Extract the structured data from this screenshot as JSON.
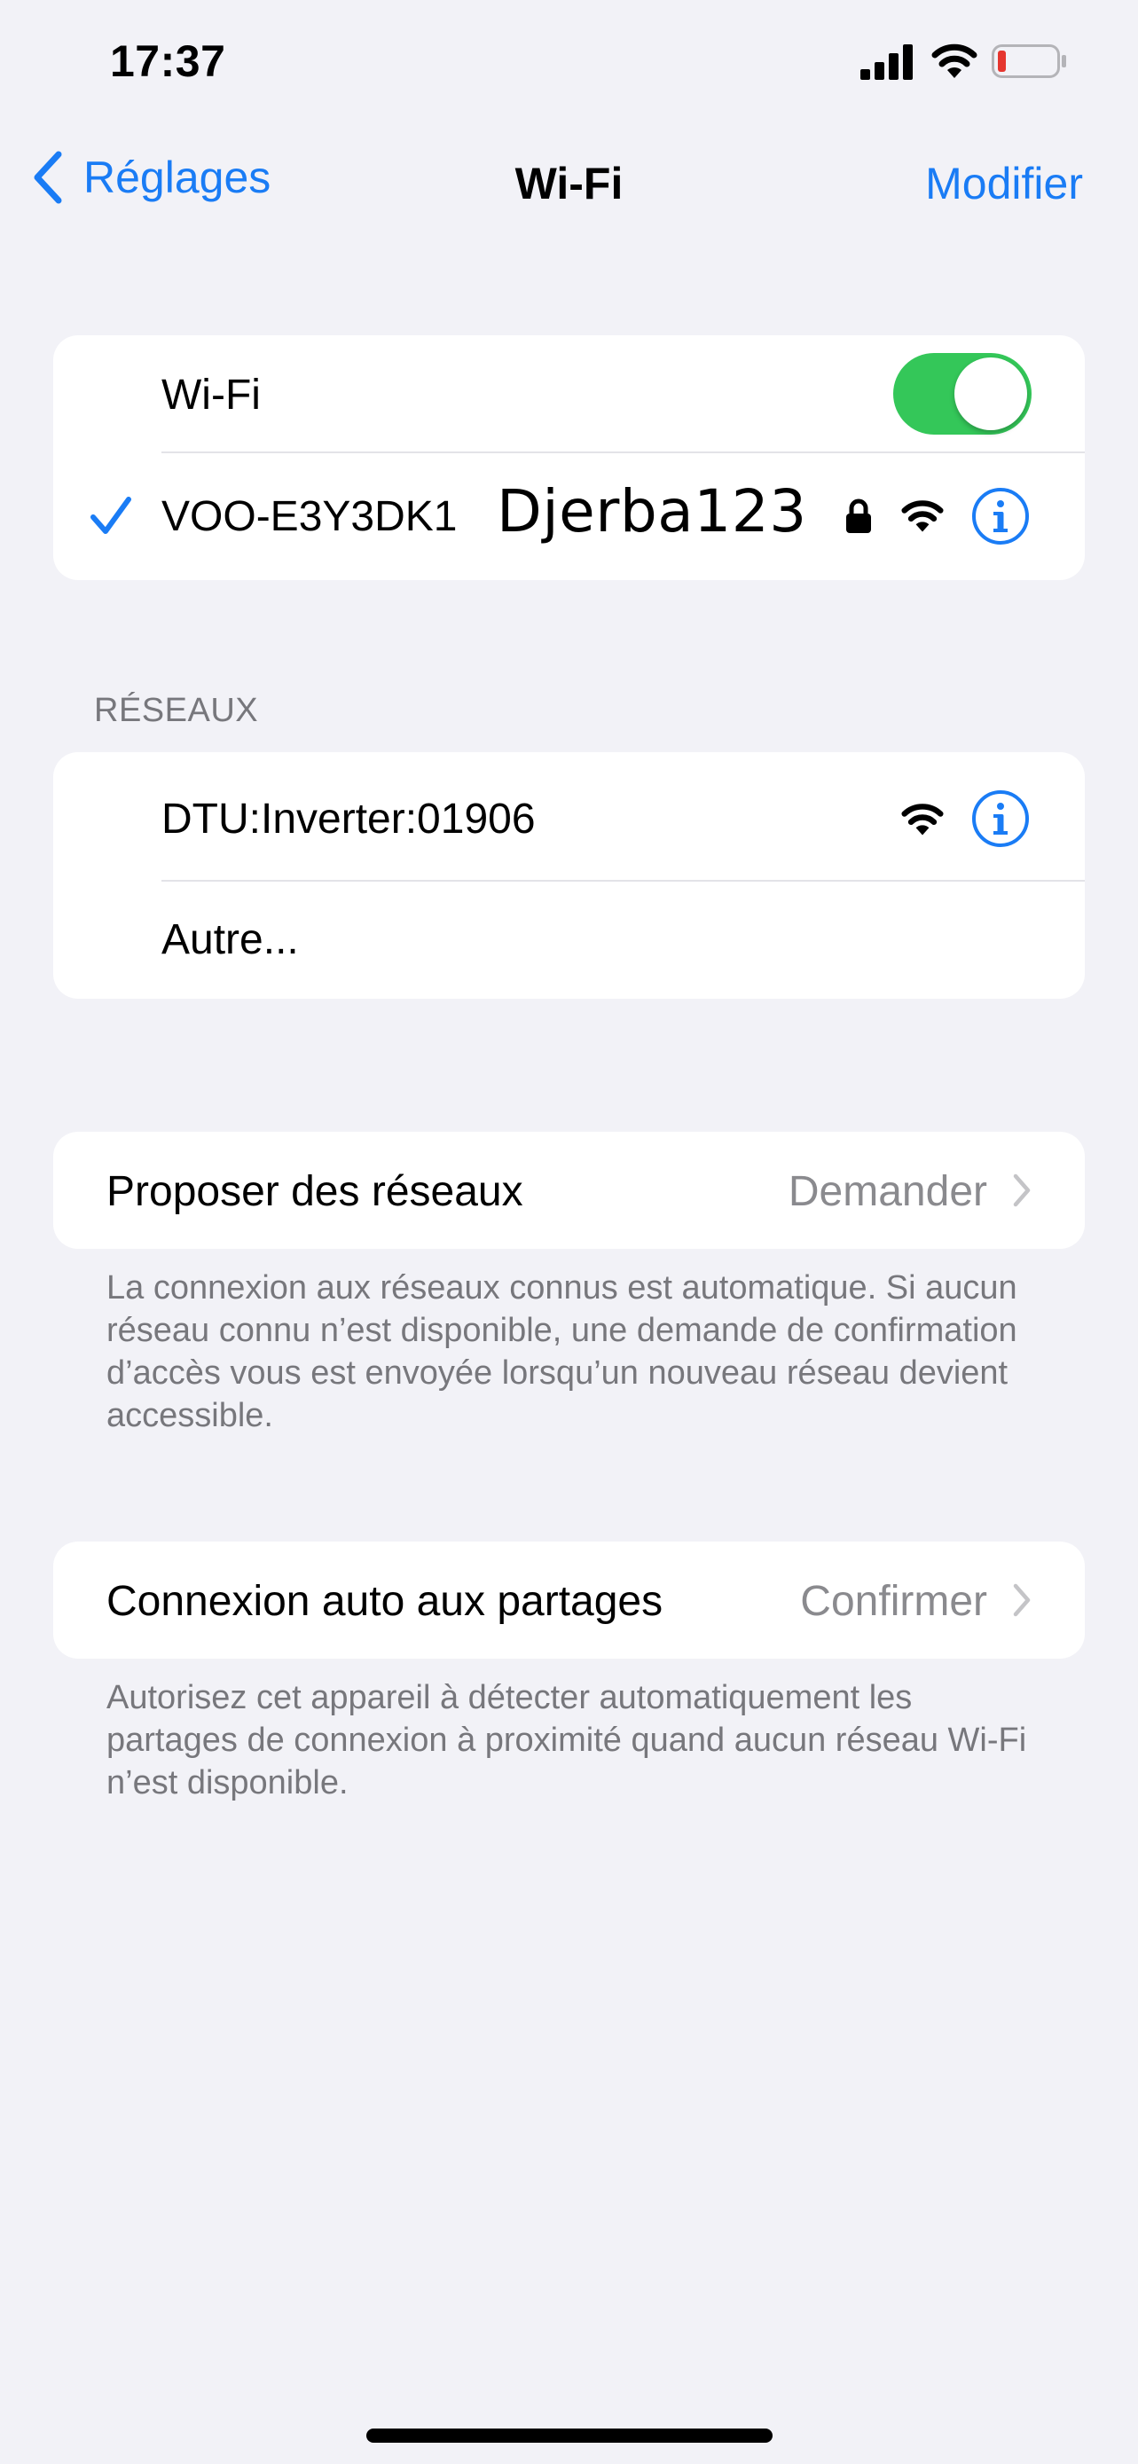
{
  "status_bar": {
    "time": "17:37"
  },
  "nav": {
    "back_label": "Réglages",
    "title": "Wi-Fi",
    "edit_label": "Modifier"
  },
  "wifi_card": {
    "toggle_label": "Wi-Fi",
    "toggle_on": true,
    "connected_network": "VOO-E3Y3DK1",
    "handwritten_note": "Djerba123"
  },
  "networks": {
    "section_title": "RÉSEAUX",
    "items": [
      {
        "name": "DTU:Inverter:01906"
      },
      {
        "name": "Autre..."
      }
    ]
  },
  "propose_networks": {
    "label": "Proposer des réseaux",
    "value": "Demander",
    "footnote": "La connexion aux réseaux connus est automatique. Si aucun réseau connu n’est disponible, une demande de confirmation d’accès vous est envoyée lorsqu’un nouveau réseau devient accessible."
  },
  "auto_hotspot": {
    "label": "Connexion auto aux partages",
    "value": "Confirmer",
    "footnote": "Autorisez cet appareil à détecter automatiquement les partages de connexion à proximité quand aucun réseau Wi-Fi n’est disponible."
  },
  "colors": {
    "accent": "#1a7cf5",
    "toggle_on": "#34c759",
    "battery_low": "#e5362f",
    "background": "#f2f2f7"
  },
  "icons": [
    "cellular-signal-icon",
    "wifi-icon",
    "battery-low-icon",
    "chevron-left-icon",
    "checkmark-icon",
    "lock-icon",
    "info-icon",
    "chevron-right-icon"
  ]
}
